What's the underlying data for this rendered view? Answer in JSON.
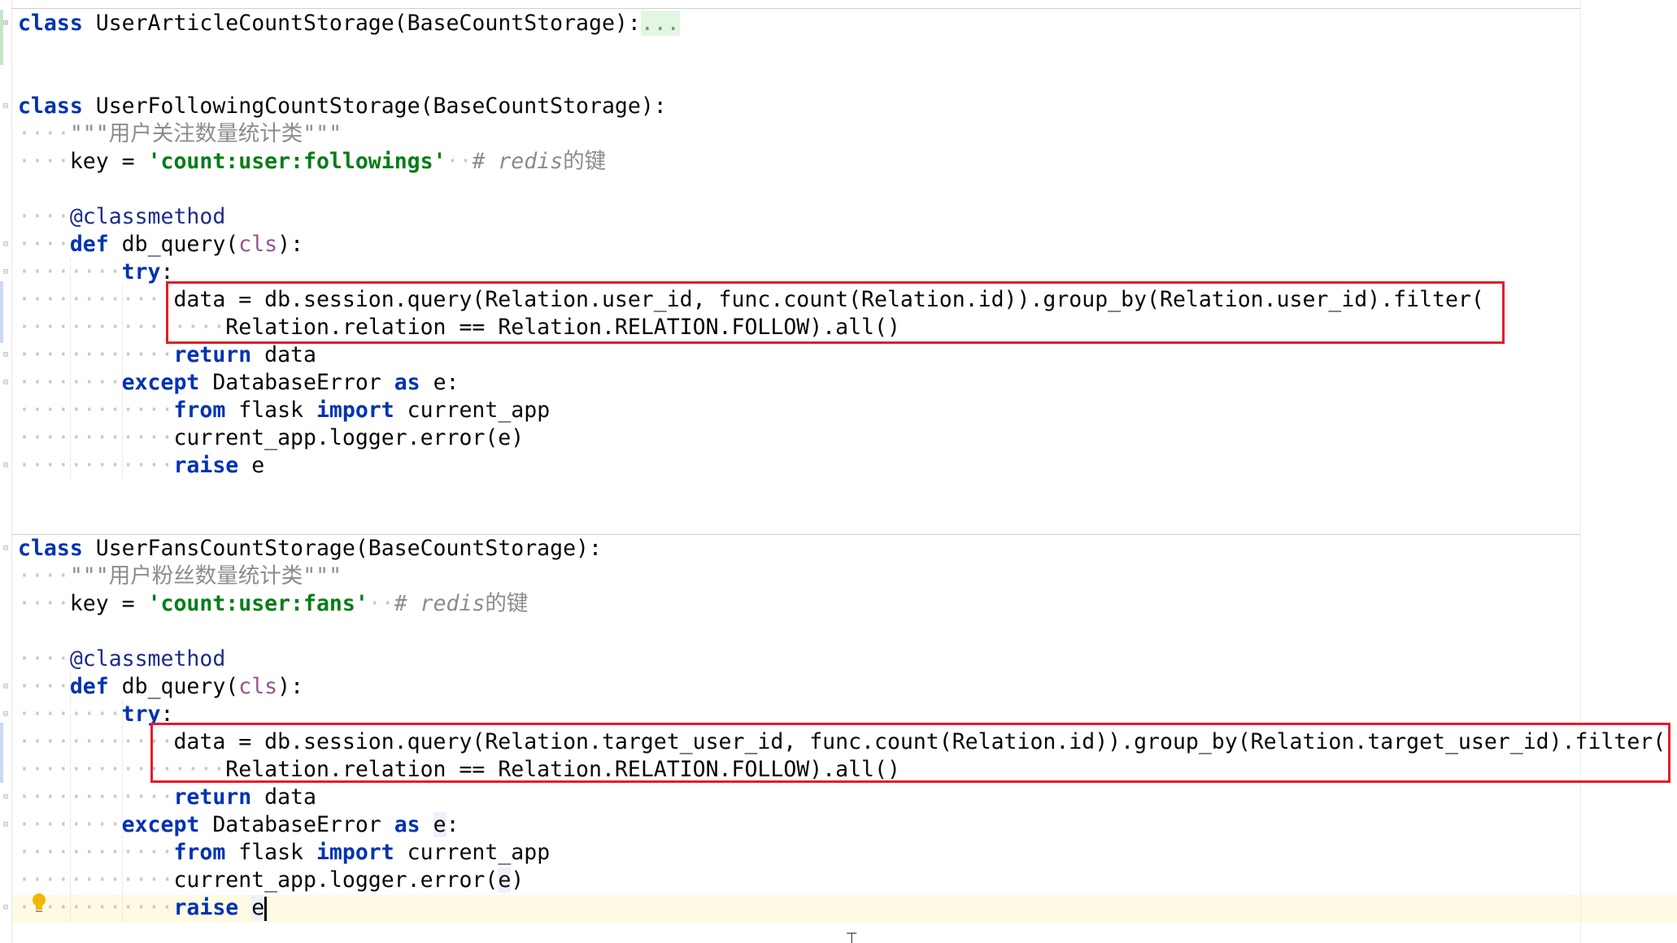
{
  "editor": {
    "lines": [
      {
        "segments": [
          {
            "t": "class",
            "c": "kw"
          },
          {
            "t": " UserArticleCountStorage(BaseCountStorage):"
          },
          {
            "t": "...",
            "c": "dots"
          }
        ]
      },
      {
        "segments": []
      },
      {
        "segments": []
      },
      {
        "segments": [
          {
            "t": "class",
            "c": "kw"
          },
          {
            "t": " UserFollowingCountStorage(BaseCountStorage):"
          }
        ]
      },
      {
        "segments": [
          {
            "t": "····",
            "c": "ws"
          },
          {
            "t": "\"\"\"用户关注数量统计类\"\"\"",
            "c": "doc"
          }
        ]
      },
      {
        "segments": [
          {
            "t": "····",
            "c": "ws"
          },
          {
            "t": "key = "
          },
          {
            "t": "'count:user:followings'",
            "c": "str"
          },
          {
            "t": "··",
            "c": "ws"
          },
          {
            "t": "# redis",
            "c": "cmt"
          },
          {
            "t": "的键",
            "c": "cmt-cn"
          }
        ]
      },
      {
        "segments": []
      },
      {
        "segments": [
          {
            "t": "····",
            "c": "ws"
          },
          {
            "t": "@classmethod",
            "c": "dec"
          }
        ]
      },
      {
        "segments": [
          {
            "t": "····",
            "c": "ws"
          },
          {
            "t": "def",
            "c": "kw"
          },
          {
            "t": " db_query("
          },
          {
            "t": "cls",
            "c": "self"
          },
          {
            "t": "):"
          }
        ]
      },
      {
        "segments": [
          {
            "t": "········",
            "c": "ws"
          },
          {
            "t": "try",
            "c": "kw"
          },
          {
            "t": ":"
          }
        ]
      },
      {
        "segments": [
          {
            "t": "············",
            "c": "ws"
          },
          {
            "t": "data = db.session.query(Relation.user_id, func.count(Relation.id)).group_by(Relation.user_id).filter("
          }
        ]
      },
      {
        "segments": [
          {
            "t": "················",
            "c": "ws"
          },
          {
            "t": "Relation.relation == Relation.RELATION.FOLLOW).all()"
          }
        ]
      },
      {
        "segments": [
          {
            "t": "············",
            "c": "ws"
          },
          {
            "t": "return",
            "c": "kw"
          },
          {
            "t": " data"
          }
        ]
      },
      {
        "segments": [
          {
            "t": "········",
            "c": "ws"
          },
          {
            "t": "except",
            "c": "kw"
          },
          {
            "t": " DatabaseError "
          },
          {
            "t": "as",
            "c": "kw"
          },
          {
            "t": " e:"
          }
        ]
      },
      {
        "segments": [
          {
            "t": "············",
            "c": "ws"
          },
          {
            "t": "from",
            "c": "kw"
          },
          {
            "t": " flask "
          },
          {
            "t": "import",
            "c": "kw"
          },
          {
            "t": " current_app"
          }
        ]
      },
      {
        "segments": [
          {
            "t": "············",
            "c": "ws"
          },
          {
            "t": "current_app.logger.error(e)"
          }
        ]
      },
      {
        "segments": [
          {
            "t": "············",
            "c": "ws"
          },
          {
            "t": "raise",
            "c": "kw"
          },
          {
            "t": " e"
          }
        ]
      },
      {
        "segments": []
      },
      {
        "segments": []
      },
      {
        "segments": [
          {
            "t": "class",
            "c": "kw"
          },
          {
            "t": " UserFansCountStorage(BaseCountStorage):"
          }
        ]
      },
      {
        "segments": [
          {
            "t": "····",
            "c": "ws"
          },
          {
            "t": "\"\"\"用户粉丝数量统计类\"\"\"",
            "c": "doc"
          }
        ]
      },
      {
        "segments": [
          {
            "t": "····",
            "c": "ws"
          },
          {
            "t": "key = "
          },
          {
            "t": "'count:user:fans'",
            "c": "str"
          },
          {
            "t": "··",
            "c": "ws"
          },
          {
            "t": "# redis",
            "c": "cmt"
          },
          {
            "t": "的键",
            "c": "cmt-cn"
          }
        ]
      },
      {
        "segments": []
      },
      {
        "segments": [
          {
            "t": "····",
            "c": "ws"
          },
          {
            "t": "@classmethod",
            "c": "dec"
          }
        ]
      },
      {
        "segments": [
          {
            "t": "····",
            "c": "ws"
          },
          {
            "t": "def",
            "c": "kw"
          },
          {
            "t": " db_query("
          },
          {
            "t": "cls",
            "c": "self"
          },
          {
            "t": "):"
          }
        ]
      },
      {
        "segments": [
          {
            "t": "········",
            "c": "ws"
          },
          {
            "t": "try",
            "c": "kw"
          },
          {
            "t": ":"
          }
        ]
      },
      {
        "segments": [
          {
            "t": "············",
            "c": "ws"
          },
          {
            "t": "data = db.session.query(Relation.target_user_id, func.count(Relation.id)).group_by(Relation.target_user_id).filter("
          }
        ]
      },
      {
        "segments": [
          {
            "t": "················",
            "c": "ws"
          },
          {
            "t": "Relation.relation == Relation.RELATION.FOLLOW).all()"
          }
        ]
      },
      {
        "segments": [
          {
            "t": "············",
            "c": "ws"
          },
          {
            "t": "return",
            "c": "kw"
          },
          {
            "t": " data"
          }
        ]
      },
      {
        "segments": [
          {
            "t": "········",
            "c": "ws"
          },
          {
            "t": "except",
            "c": "kw"
          },
          {
            "t": " DatabaseError "
          },
          {
            "t": "as",
            "c": "kw"
          },
          {
            "t": " "
          },
          {
            "t": "e",
            "c": "ident-hl"
          },
          {
            "t": ":"
          }
        ]
      },
      {
        "segments": [
          {
            "t": "············",
            "c": "ws"
          },
          {
            "t": "from",
            "c": "kw"
          },
          {
            "t": " flask "
          },
          {
            "t": "import",
            "c": "kw"
          },
          {
            "t": " current_app"
          }
        ]
      },
      {
        "segments": [
          {
            "t": "············",
            "c": "ws"
          },
          {
            "t": "current_app.logger.error("
          },
          {
            "t": "e",
            "c": "ident-hl"
          },
          {
            "t": ")"
          }
        ]
      },
      {
        "segments": [
          {
            "t": "············",
            "c": "ws"
          },
          {
            "t": "raise",
            "c": "kw"
          },
          {
            "t": " "
          },
          {
            "t": "e",
            "c": "ident-hl"
          }
        ]
      }
    ]
  },
  "icons": {
    "intention": "lightbulb-icon",
    "fold": "fold-marker-icon",
    "cursor": "text-cursor-icon"
  },
  "colors": {
    "keyword": "#0033b3",
    "string": "#067d17",
    "comment": "#8c8c8c",
    "highlight_box": "#e21d2b",
    "caret_line": "#fffae3"
  }
}
